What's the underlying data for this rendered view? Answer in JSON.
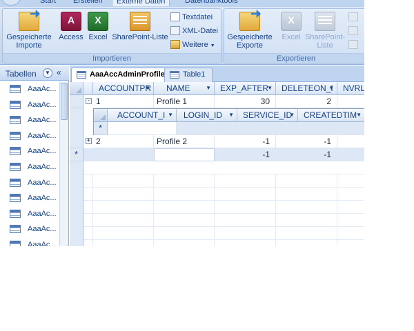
{
  "ribbon_tabs": [
    "Start",
    "Erstellen",
    "Externe Daten",
    "Datenbanktools"
  ],
  "ribbon_active_tab": "Externe Daten",
  "importieren": {
    "title": "Importieren",
    "saved_imports": "Gespeicherte Importe",
    "access": "Access",
    "excel": "Excel",
    "sharepoint": "SharePoint-Liste",
    "textfile": "Textdatei",
    "xmlfile": "XML-Datei",
    "more": "Weitere"
  },
  "exportieren": {
    "title": "Exportieren",
    "saved_exports": "Gespeicherte Exporte",
    "excel": "Excel",
    "sharepoint": "SharePoint-Liste"
  },
  "nav": {
    "title": "Tabellen",
    "collapse_glyph": "«",
    "items": [
      "AaaAc...",
      "AaaAc...",
      "AaaAc...",
      "AaaAc...",
      "AaaAc...",
      "AaaAc...",
      "AaaAc...",
      "AaaAc...",
      "AaaAc...",
      "AaaAc...",
      "AaaAc..."
    ]
  },
  "doc_tabs": [
    "AaaAccAdminProfile",
    "Table1"
  ],
  "doc_tab_active": "AaaAccAdminProfile",
  "datasheet": {
    "columns": [
      "ACCOUNTPR",
      "NAME",
      "EXP_AFTER",
      "DELETEON_I",
      "NVRLO"
    ],
    "rows": [
      {
        "expander": "-",
        "id": "1",
        "name": "Profile 1",
        "exp_after": "30",
        "deleteon": "2"
      },
      {
        "expander": "+",
        "id": "2",
        "name": "Profile 2",
        "exp_after": "-1",
        "deleteon": "-1"
      }
    ],
    "new_row": {
      "marker": "*",
      "exp_after": "-1",
      "deleteon": "-1"
    },
    "subsheet": {
      "columns": [
        "ACCOUNT_I",
        "LOGIN_ID",
        "SERVICE_ID",
        "CREATEDTIM"
      ],
      "new_row_marker": "*"
    }
  }
}
